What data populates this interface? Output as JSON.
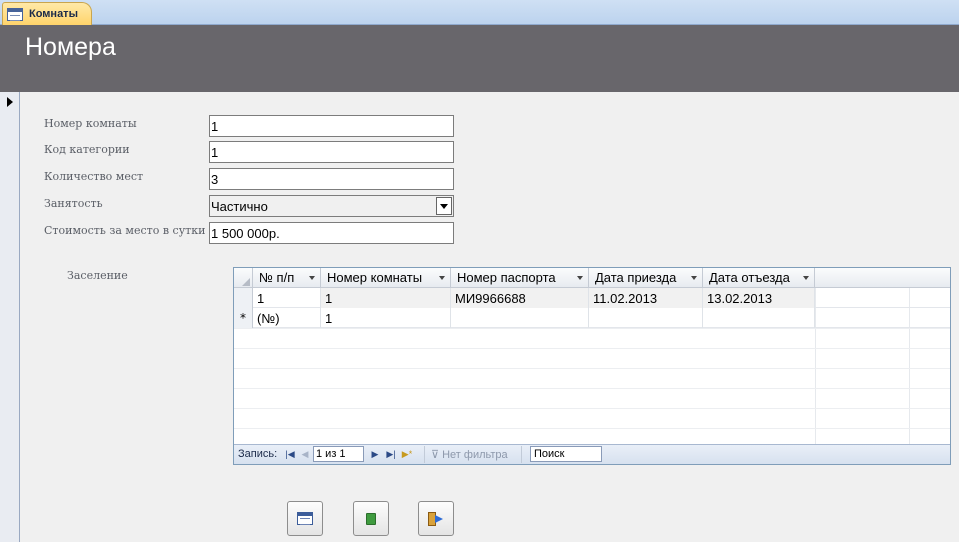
{
  "tab": {
    "label": "Комнаты",
    "icon": "form-icon"
  },
  "header": {
    "title": "Номера"
  },
  "fields": {
    "room_number": {
      "label": "Номер комнаты",
      "value": "1"
    },
    "category_code": {
      "label": "Код категории",
      "value": "1"
    },
    "places_count": {
      "label": "Количество мест",
      "value": "3"
    },
    "occupancy": {
      "label": "Занятость",
      "value": "Частично"
    },
    "price": {
      "label": "Стоимость за место в сутки",
      "value": "1 500 000р."
    }
  },
  "subform": {
    "label": "Заселение",
    "columns": [
      "№ п/п",
      "Номер комнаты",
      "Номер паспорта",
      "Дата приезда",
      "Дата отъезда"
    ],
    "rows": [
      [
        "1",
        "1",
        "МИ9966688",
        "11.02.2013",
        "13.02.2013"
      ]
    ],
    "new_row": {
      "marker": "*",
      "id": "(№)",
      "room": "1"
    },
    "nav": {
      "label": "Запись:",
      "position": "1 из 1",
      "filter": "Нет фильтра",
      "search": "Поиск"
    }
  },
  "buttons": {
    "open_form": {
      "icon": "form-icon"
    },
    "save": {
      "icon": "save-icon"
    },
    "exit": {
      "icon": "exit-icon"
    }
  }
}
